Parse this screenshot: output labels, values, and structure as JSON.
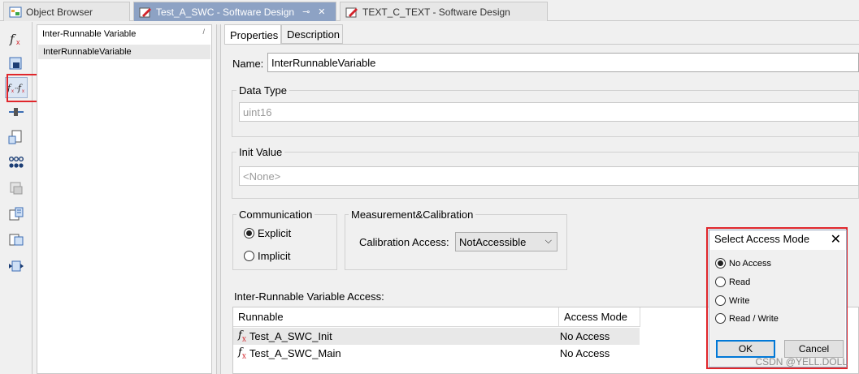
{
  "tabs": [
    {
      "label": "Object Browser",
      "active": false
    },
    {
      "label": "Test_A_SWC - Software Design",
      "active": true
    },
    {
      "label": "TEXT_C_TEXT - Software Design",
      "active": false
    }
  ],
  "list": {
    "header": "Inter-Runnable Variable",
    "sort_glyph": "/",
    "items": [
      "InterRunnableVariable"
    ]
  },
  "property_tabs": [
    "Properties",
    "Description"
  ],
  "form": {
    "name_label": "Name:",
    "name_value": "InterRunnableVariable",
    "data_type_label": "Data Type",
    "data_type_value": "uint16",
    "init_value_label": "Init Value",
    "init_value_value": "<None>",
    "communication": {
      "title": "Communication",
      "options": [
        "Explicit",
        "Implicit"
      ],
      "selected": "Explicit"
    },
    "measurement": {
      "title": "Measurement&Calibration",
      "calibration_label": "Calibration Access:",
      "calibration_value": "NotAccessible"
    }
  },
  "access_table": {
    "title": "Inter-Runnable Variable Access:",
    "columns": [
      "Runnable",
      "Access Mode"
    ],
    "rows": [
      {
        "runnable": "Test_A_SWC_Init",
        "mode": "No Access"
      },
      {
        "runnable": "Test_A_SWC_Main",
        "mode": "No Access"
      }
    ]
  },
  "dialog": {
    "title": "Select Access Mode",
    "close_glyph": "✕",
    "options": [
      "No Access",
      "Read",
      "Write",
      "Read / Write"
    ],
    "selected": "No Access",
    "ok_label": "OK",
    "cancel_label": "Cancel"
  },
  "watermark": "CSDN @YELL.DOLL",
  "colors": {
    "highlight_box": "#e0262b",
    "active_tab": "#8da2c4",
    "default_button_border": "#0078d7"
  }
}
